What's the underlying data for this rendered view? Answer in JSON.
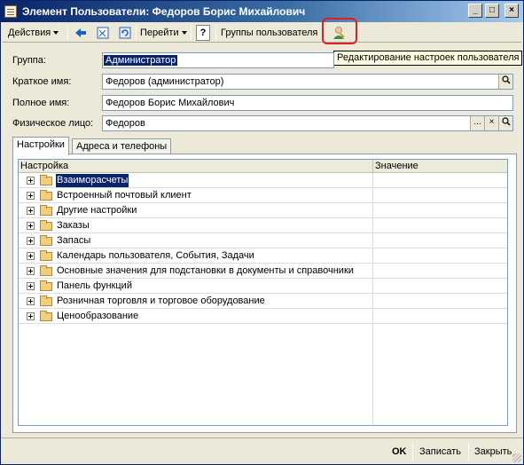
{
  "window": {
    "title": "Элемент Пользователи: Федоров Борис Михайлович",
    "controls": {
      "minimize": "_",
      "maximize": "□",
      "close": "×"
    }
  },
  "toolbar": {
    "actions_label": "Действия",
    "goto_label": "Перейти",
    "help_label": "?",
    "user_groups_label": "Группы пользователя",
    "icons": [
      "arrow-left-icon",
      "document-icon",
      "refresh-icon",
      "user-settings-icon"
    ]
  },
  "tooltip": {
    "text": "Редактирование настроек пользователя"
  },
  "form": {
    "group_label": "Группа:",
    "group_value": "Администратор",
    "short_name_label": "Краткое имя:",
    "short_name_value": "Федоров (администратор)",
    "full_name_label": "Полное имя:",
    "full_name_value": "Федоров Борис Михайлович",
    "person_label": "Физическое лицо:",
    "person_value": "Федоров",
    "ellipsis_button": "...",
    "clear_button": "×"
  },
  "tabs": [
    {
      "label": "Настройки"
    },
    {
      "label": "Адреса и телефоны"
    }
  ],
  "tree": {
    "col_setting": "Настройка",
    "col_value": "Значение",
    "rows": [
      {
        "label": "Взаиморасчеты"
      },
      {
        "label": "Встроенный почтовый клиент"
      },
      {
        "label": "Другие настройки"
      },
      {
        "label": "Заказы"
      },
      {
        "label": "Запасы"
      },
      {
        "label": "Календарь пользователя, События, Задачи"
      },
      {
        "label": "Основные значения для подстановки в документы и справочники"
      },
      {
        "label": "Панель функций"
      },
      {
        "label": "Розничная торговля и торговое оборудование"
      },
      {
        "label": "Ценообразование"
      }
    ]
  },
  "footer": {
    "ok_label": "OK",
    "save_label": "Записать",
    "close_label": "Закрыть"
  },
  "colors": {
    "selection": "#0a246a",
    "highlight_box": "#e02020",
    "tooltip_bg": "#ffffe1"
  }
}
